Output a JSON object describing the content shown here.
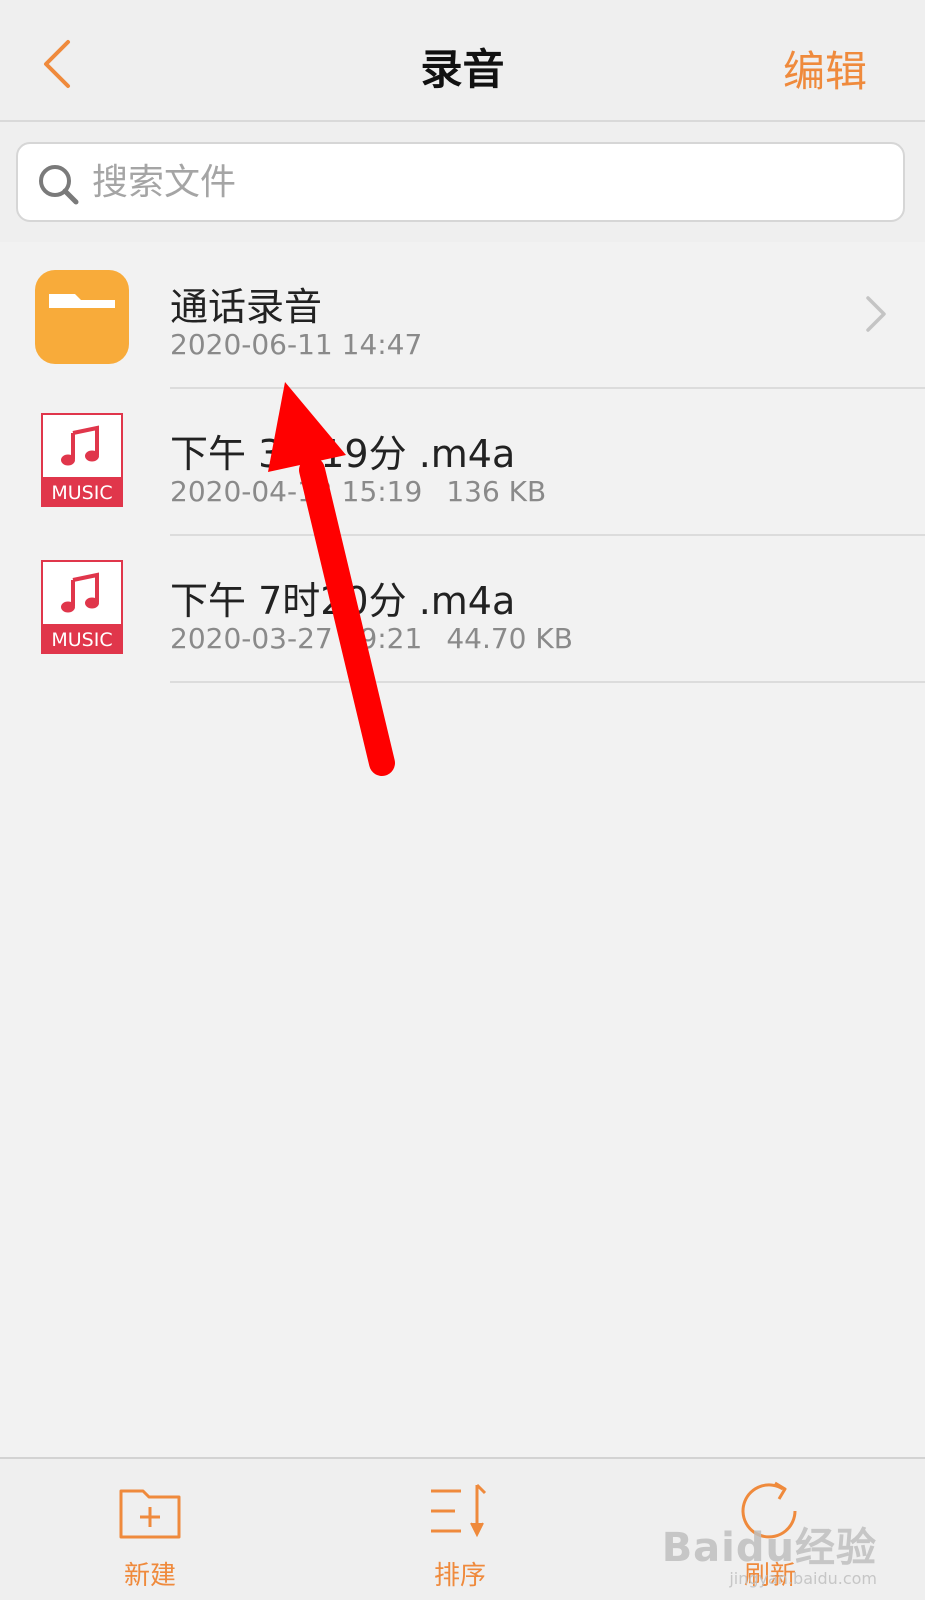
{
  "nav": {
    "back_icon": "chevron-left-icon",
    "title": "录音",
    "edit_label": "编辑"
  },
  "search": {
    "placeholder": "搜索文件",
    "icon": "search-icon"
  },
  "files": [
    {
      "type": "folder",
      "icon": "folder-icon",
      "name": "通话录音",
      "date": "2020-06-11 14:47",
      "size": ""
    },
    {
      "type": "audio",
      "icon": "music-file-icon",
      "icon_label": "MUSIC",
      "name": "下午 3时19分 .m4a",
      "date": "2020-04-12 15:19",
      "size": "136 KB"
    },
    {
      "type": "audio",
      "icon": "music-file-icon",
      "icon_label": "MUSIC",
      "name": "下午 7时20分 .m4a",
      "date": "2020-03-27 19:21",
      "size": "44.70 KB"
    }
  ],
  "toolbar": {
    "new_label": "新建",
    "sort_label": "排序",
    "refresh_label": "刷新"
  },
  "watermark": {
    "main": "Baidu经验",
    "sub": "jingyan.baidu.com"
  },
  "colors": {
    "accent": "#ef8a3c",
    "folder": "#f8ab3a",
    "music": "#e0364b",
    "arrow": "#ff0000"
  }
}
